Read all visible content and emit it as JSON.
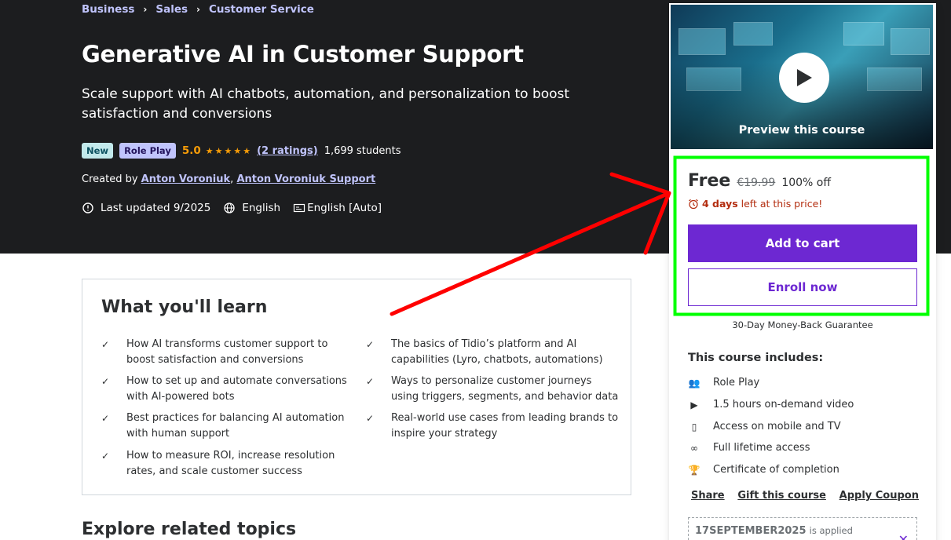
{
  "breadcrumb": [
    "Business",
    "Sales",
    "Customer Service"
  ],
  "breadcrumb_separator": "›",
  "course": {
    "title": "Generative AI in Customer Support",
    "subtitle": "Scale support with AI chatbots, automation, and personalization to boost satisfaction and conversions",
    "badge_new": "New",
    "badge_role": "Role Play",
    "rating": "5.0",
    "stars": "★★★★★",
    "ratings_count": "(2 ratings)",
    "students": "1,699 students",
    "created_by_label": "Created by",
    "instructors": [
      "Anton Voroniuk",
      "Anton Voroniuk Support"
    ],
    "instructor_separator": ",",
    "last_updated": "Last updated 9/2025",
    "language": "English",
    "captions": "English [Auto]"
  },
  "learn": {
    "title": "What you'll learn",
    "check_glyph": "✓",
    "items": [
      "How AI transforms customer support to boost satisfaction and conversions",
      "The basics of Tidio’s platform and AI capabilities (Lyro, chatbots, automations)",
      "How to set up and automate conversations with AI-powered bots",
      "Ways to personalize customer journeys using triggers, segments, and behavior data",
      "Best practices for balancing AI automation with human support",
      "Real-world use cases from leading brands to inspire your strategy",
      "How to measure ROI, increase resolution rates, and scale customer success"
    ]
  },
  "related_title": "Explore related topics",
  "sidebar": {
    "preview_label": "Preview this course",
    "price_now": "Free",
    "price_old": "€19.99",
    "price_off": "100% off",
    "timer_days": "4 days",
    "timer_text": "left at this price!",
    "add_to_cart": "Add to cart",
    "enroll_now": "Enroll now",
    "guarantee": "30-Day Money-Back Guarantee",
    "includes_title": "This course includes:",
    "includes": [
      {
        "icon": "role-play-icon",
        "glyph": "👥",
        "label": "Role Play"
      },
      {
        "icon": "video-icon",
        "glyph": "▶",
        "label": "1.5 hours on-demand video"
      },
      {
        "icon": "mobile-icon",
        "glyph": "▯",
        "label": "Access on mobile and TV"
      },
      {
        "icon": "infinity-icon",
        "glyph": "∞",
        "label": "Full lifetime access"
      },
      {
        "icon": "trophy-icon",
        "glyph": "🏆",
        "label": "Certificate of completion"
      }
    ],
    "share": "Share",
    "gift": "Gift this course",
    "apply_coupon": "Apply Coupon",
    "coupon_code": "17SEPTEMBER2025",
    "coupon_applied": "is applied",
    "coupon_close": "✕"
  },
  "colors": {
    "hero_bg": "#1c1d1f",
    "accent_purple": "#6d28d2",
    "link_purple": "#c0c4fc",
    "star_orange": "#f69c08",
    "timer_red": "#b32d0f",
    "annotation_red": "#ff0000",
    "annotation_green": "#00ff00"
  }
}
